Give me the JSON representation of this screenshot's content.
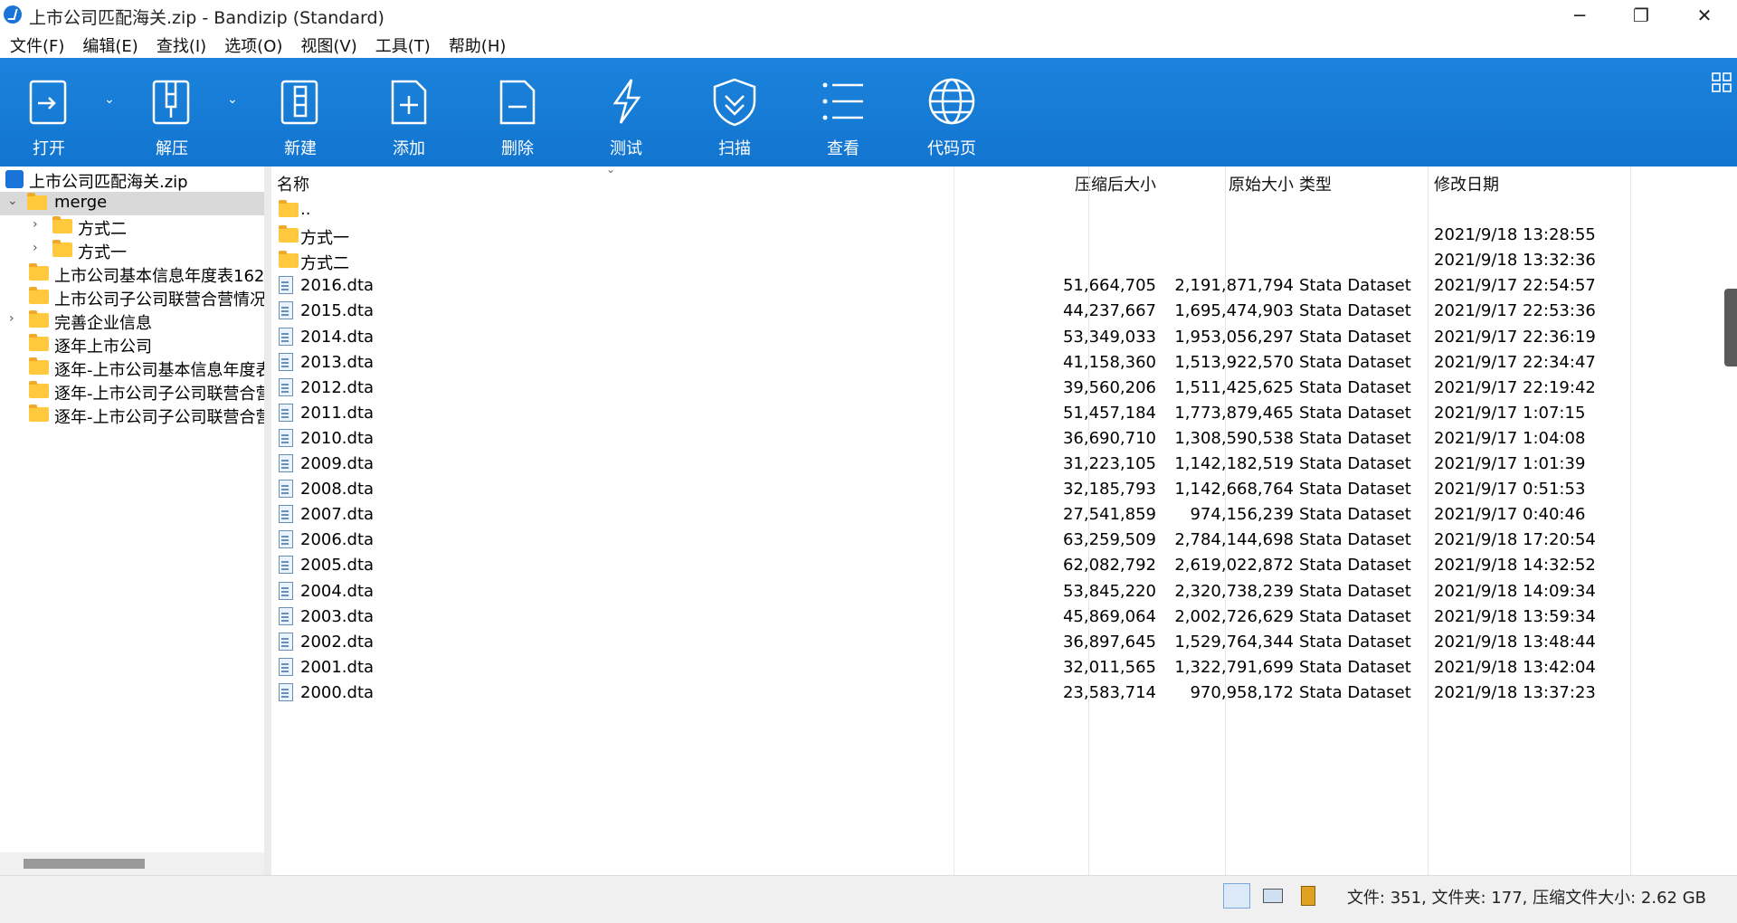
{
  "window": {
    "title": "上市公司匹配海关.zip - Bandizip (Standard)",
    "minimize": "─",
    "maximize": "❐",
    "close": "✕"
  },
  "menu": [
    "文件(F)",
    "编辑(E)",
    "查找(I)",
    "选项(O)",
    "视图(V)",
    "工具(T)",
    "帮助(H)"
  ],
  "toolbar": {
    "open": "打开",
    "extract": "解压",
    "new": "新建",
    "add": "添加",
    "delete": "删除",
    "test": "测试",
    "scan": "扫描",
    "view": "查看",
    "codepage": "代码页"
  },
  "tree": {
    "root": "上市公司匹配海关.zip",
    "items": [
      {
        "label": "merge"
      },
      {
        "label": "方式二"
      },
      {
        "label": "方式一"
      },
      {
        "label": "上市公司基本信息年度表162"
      },
      {
        "label": "上市公司子公司联营合营情况"
      },
      {
        "label": "完善企业信息"
      },
      {
        "label": "逐年上市公司"
      },
      {
        "label": "逐年-上市公司基本信息年度表"
      },
      {
        "label": "逐年-上市公司子公司联营合营"
      },
      {
        "label": "逐年-上市公司子公司联营合营"
      }
    ]
  },
  "columns": {
    "name": "名称",
    "packed": "压缩后大小",
    "original": "原始大小",
    "type": "类型",
    "modified": "修改日期"
  },
  "rows": [
    {
      "name": "..",
      "packed": "",
      "original": "",
      "type": "",
      "modified": "",
      "kind": "folder"
    },
    {
      "name": "方式一",
      "packed": "",
      "original": "",
      "type": "",
      "modified": "2021/9/18 13:28:55",
      "kind": "folder"
    },
    {
      "name": "方式二",
      "packed": "",
      "original": "",
      "type": "",
      "modified": "2021/9/18 13:32:36",
      "kind": "folder"
    },
    {
      "name": "2016.dta",
      "packed": "51,664,705",
      "original": "2,191,871,794",
      "type": "Stata Dataset",
      "modified": "2021/9/17 22:54:57",
      "kind": "file"
    },
    {
      "name": "2015.dta",
      "packed": "44,237,667",
      "original": "1,695,474,903",
      "type": "Stata Dataset",
      "modified": "2021/9/17 22:53:36",
      "kind": "file"
    },
    {
      "name": "2014.dta",
      "packed": "53,349,033",
      "original": "1,953,056,297",
      "type": "Stata Dataset",
      "modified": "2021/9/17 22:36:19",
      "kind": "file"
    },
    {
      "name": "2013.dta",
      "packed": "41,158,360",
      "original": "1,513,922,570",
      "type": "Stata Dataset",
      "modified": "2021/9/17 22:34:47",
      "kind": "file"
    },
    {
      "name": "2012.dta",
      "packed": "39,560,206",
      "original": "1,511,425,625",
      "type": "Stata Dataset",
      "modified": "2021/9/17 22:19:42",
      "kind": "file"
    },
    {
      "name": "2011.dta",
      "packed": "51,457,184",
      "original": "1,773,879,465",
      "type": "Stata Dataset",
      "modified": "2021/9/17 1:07:15",
      "kind": "file"
    },
    {
      "name": "2010.dta",
      "packed": "36,690,710",
      "original": "1,308,590,538",
      "type": "Stata Dataset",
      "modified": "2021/9/17 1:04:08",
      "kind": "file"
    },
    {
      "name": "2009.dta",
      "packed": "31,223,105",
      "original": "1,142,182,519",
      "type": "Stata Dataset",
      "modified": "2021/9/17 1:01:39",
      "kind": "file"
    },
    {
      "name": "2008.dta",
      "packed": "32,185,793",
      "original": "1,142,668,764",
      "type": "Stata Dataset",
      "modified": "2021/9/17 0:51:53",
      "kind": "file"
    },
    {
      "name": "2007.dta",
      "packed": "27,541,859",
      "original": "974,156,239",
      "type": "Stata Dataset",
      "modified": "2021/9/17 0:40:46",
      "kind": "file"
    },
    {
      "name": "2006.dta",
      "packed": "63,259,509",
      "original": "2,784,144,698",
      "type": "Stata Dataset",
      "modified": "2021/9/18 17:20:54",
      "kind": "file"
    },
    {
      "name": "2005.dta",
      "packed": "62,082,792",
      "original": "2,619,022,872",
      "type": "Stata Dataset",
      "modified": "2021/9/18 14:32:52",
      "kind": "file"
    },
    {
      "name": "2004.dta",
      "packed": "53,845,220",
      "original": "2,320,738,239",
      "type": "Stata Dataset",
      "modified": "2021/9/18 14:09:34",
      "kind": "file"
    },
    {
      "name": "2003.dta",
      "packed": "45,869,064",
      "original": "2,002,726,629",
      "type": "Stata Dataset",
      "modified": "2021/9/18 13:59:34",
      "kind": "file"
    },
    {
      "name": "2002.dta",
      "packed": "36,897,645",
      "original": "1,529,764,344",
      "type": "Stata Dataset",
      "modified": "2021/9/18 13:48:44",
      "kind": "file"
    },
    {
      "name": "2001.dta",
      "packed": "32,011,565",
      "original": "1,322,791,699",
      "type": "Stata Dataset",
      "modified": "2021/9/18 13:42:04",
      "kind": "file"
    },
    {
      "name": "2000.dta",
      "packed": "23,583,714",
      "original": "970,958,172",
      "type": "Stata Dataset",
      "modified": "2021/9/18 13:37:23",
      "kind": "file"
    }
  ],
  "status": {
    "summary": "文件: 351, 文件夹: 177, 压缩文件大小: 2.62 GB"
  },
  "colors": {
    "toolbar": "#1b83dd",
    "selection": "#d9d9d9",
    "folder": "#ffc83d"
  }
}
